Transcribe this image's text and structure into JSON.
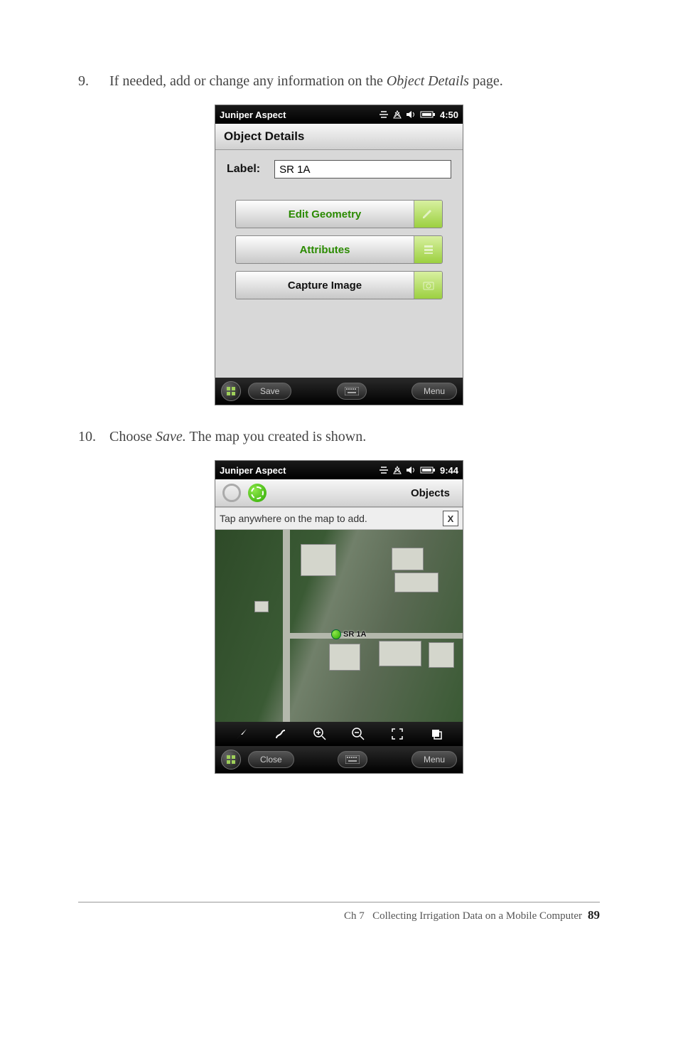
{
  "steps": {
    "s9": {
      "num": "9.",
      "pre": "If needed, add or change any information on the ",
      "italic": "Object Details",
      "post": " page."
    },
    "s10": {
      "num": "10.",
      "pre": "Choose ",
      "italic": "Save.",
      "post": " The map you created is shown."
    }
  },
  "screenshot1": {
    "status_title": "Juniper Aspect",
    "status_time": "4:50",
    "header": "Object Details",
    "label_caption": "Label:",
    "label_value": "SR 1A",
    "buttons": {
      "edit_geometry": "Edit Geometry",
      "attributes": "Attributes",
      "capture_image": "Capture Image"
    },
    "bottom": {
      "save": "Save",
      "menu": "Menu"
    }
  },
  "screenshot2": {
    "status_title": "Juniper Aspect",
    "status_time": "9:44",
    "objects_label": "Objects",
    "tip_text": "Tap anywhere on the map to add.",
    "tip_close": "X",
    "marker_label": "SR 1A",
    "bottom": {
      "close": "Close",
      "menu": "Menu"
    }
  },
  "footer": {
    "chapter": "Ch 7",
    "title": "Collecting Irrigation Data on a Mobile Computer",
    "page": "89"
  }
}
